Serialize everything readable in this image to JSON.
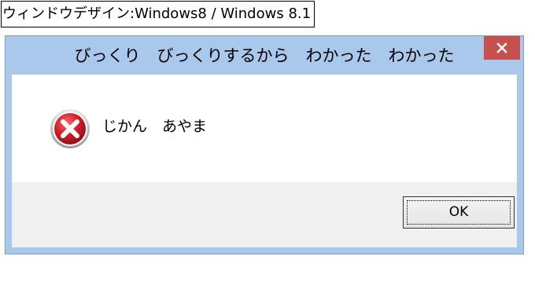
{
  "caption": "ウィンドウデザイン:Windows8 / Windows 8.1",
  "dialog": {
    "title": "びっくり　びっくりするから　わかった　わかった",
    "message": "じかん　あやま",
    "ok_label": "OK",
    "icon": "error-icon",
    "close_icon": "close-icon"
  },
  "colors": {
    "frame": "#a9c8ec",
    "close_button": "#c7504f",
    "footer": "#f0f0f0",
    "error_red": "#d21d2d"
  }
}
